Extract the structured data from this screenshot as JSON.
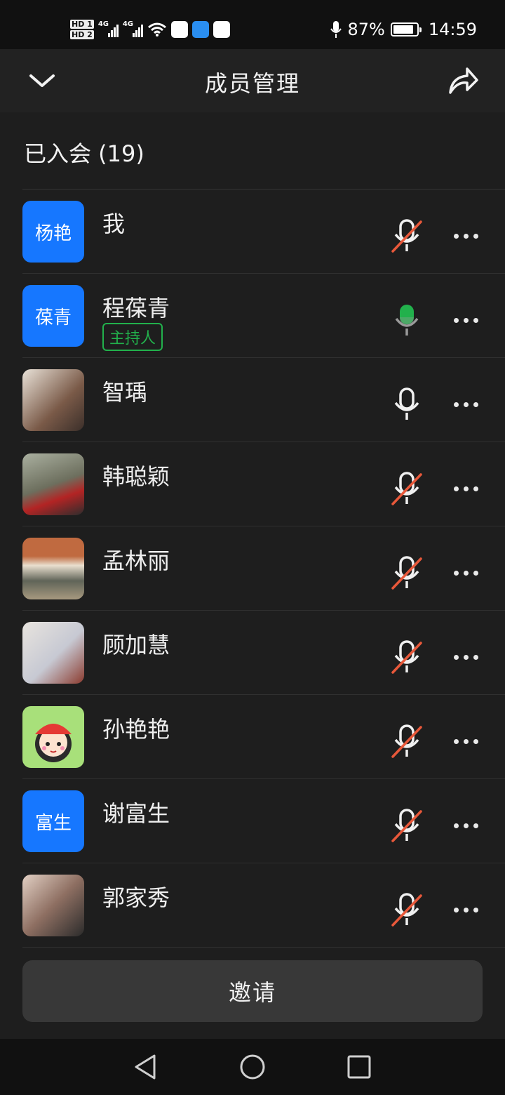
{
  "status_bar": {
    "hd1": "HD 1",
    "hd2": "HD 2",
    "net1": "4G",
    "net2": "4G",
    "battery_percent": "87%",
    "battery_level": 0.87,
    "time": "14:59"
  },
  "header": {
    "title": "成员管理"
  },
  "section": {
    "joined_label": "已入会 (19)"
  },
  "members": [
    {
      "name": "我",
      "avatar_text": "杨艳",
      "avatar_type": "text",
      "mic": "muted",
      "role": ""
    },
    {
      "name": "程葆青",
      "avatar_text": "葆青",
      "avatar_type": "text",
      "mic": "active",
      "role": "主持人"
    },
    {
      "name": "智瑀",
      "avatar_text": "",
      "avatar_type": "photo",
      "mic": "on",
      "role": ""
    },
    {
      "name": "韩聪颖",
      "avatar_text": "",
      "avatar_type": "photo",
      "mic": "muted",
      "role": ""
    },
    {
      "name": "孟林丽",
      "avatar_text": "",
      "avatar_type": "photo",
      "mic": "muted",
      "role": ""
    },
    {
      "name": "顾加慧",
      "avatar_text": "",
      "avatar_type": "photo",
      "mic": "muted",
      "role": ""
    },
    {
      "name": "孙艳艳",
      "avatar_text": "",
      "avatar_type": "cartoon",
      "mic": "muted",
      "role": ""
    },
    {
      "name": "谢富生",
      "avatar_text": "富生",
      "avatar_type": "text",
      "mic": "muted",
      "role": ""
    },
    {
      "name": "郭家秀",
      "avatar_text": "",
      "avatar_type": "photo",
      "mic": "muted",
      "role": ""
    }
  ],
  "footer": {
    "invite_label": "邀请"
  },
  "colors": {
    "accent_blue": "#1677ff",
    "host_green": "#22b14c",
    "muted_red": "#e8583a",
    "background": "#1e1e1e"
  }
}
